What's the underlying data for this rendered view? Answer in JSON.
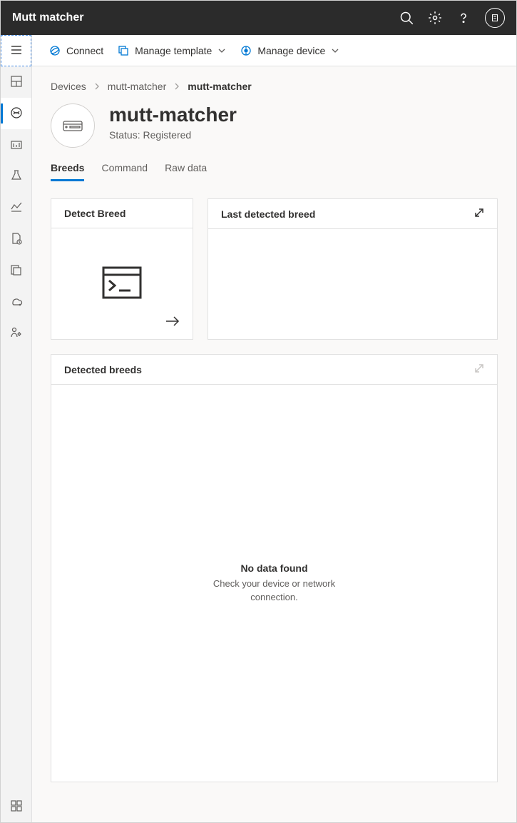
{
  "appTitle": "Mutt matcher",
  "toolbar": {
    "connect": "Connect",
    "manageTemplate": "Manage template",
    "manageDevice": "Manage device"
  },
  "breadcrumb": {
    "item0": "Devices",
    "item1": "mutt-matcher",
    "item2": "mutt-matcher"
  },
  "device": {
    "name": "mutt-matcher",
    "status": "Status: Registered"
  },
  "tabs": {
    "breeds": "Breeds",
    "command": "Command",
    "rawData": "Raw data"
  },
  "cards": {
    "detectBreed": "Detect Breed",
    "lastDetected": "Last detected breed",
    "detectedBreeds": "Detected breeds"
  },
  "emptyState": {
    "title": "No data found",
    "sub1": "Check your device or network",
    "sub2": "connection."
  }
}
